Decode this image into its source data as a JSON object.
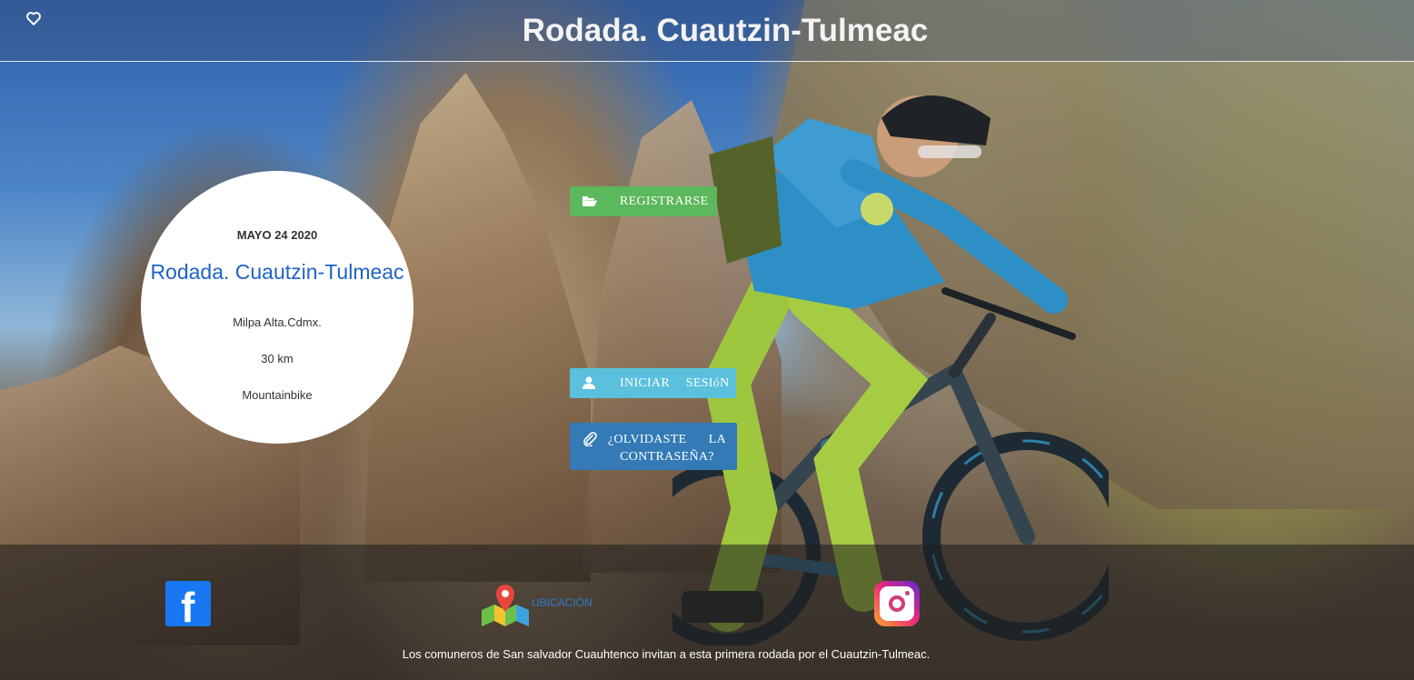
{
  "header": {
    "title": "Rodada. Cuautzin-Tulmeac",
    "favorite_icon": "heart-icon"
  },
  "event": {
    "date": "MAYO 24 2020",
    "name": "Rodada. Cuautzin-Tulmeac",
    "location": "Milpa Alta.Cdmx.",
    "distance": "30 km",
    "type": "Mountainbike"
  },
  "actions": {
    "register": {
      "label": "REGISTRARSE",
      "icon": "folder-open-icon",
      "color": "#5cb85c"
    },
    "login": {
      "label": "INICIAR SESIóN",
      "icon": "user-icon",
      "color": "#5bc0de"
    },
    "forgot": {
      "label": "¿OLVIDASTE LA CONTRASEÑA?",
      "icon": "paperclip-icon",
      "color": "#337ab7"
    }
  },
  "footer": {
    "facebook_icon": "facebook-icon",
    "location_icon": "map-pin-icon",
    "location_label": "UBICACIÓN",
    "instagram_icon": "instagram-icon",
    "message": "Los comuneros de San salvador Cuauhtenco invitan a esta primera rodada por el Cuautzin-Tulmeac."
  }
}
